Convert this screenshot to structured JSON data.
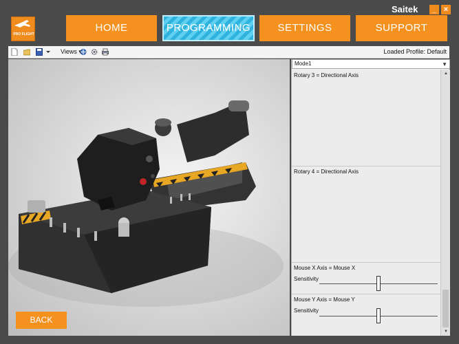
{
  "window": {
    "brand": "Saitek",
    "minimize": "_",
    "close": "×"
  },
  "logo": {
    "text": "PRO FLIGHT"
  },
  "nav": {
    "home": "HOME",
    "programming": "PROGRAMMING",
    "settings": "SETTINGS",
    "support": "SUPPORT"
  },
  "toolbar": {
    "views_label": "Views",
    "loaded_profile": "Loaded Profile: Default"
  },
  "panel": {
    "mode": "Mode1",
    "rows": [
      {
        "label": "Rotary 3 = Directional Axis"
      },
      {
        "label": "Rotary 4 = Directional Axis"
      },
      {
        "label": "Mouse X Axis = Mouse X",
        "sensitivity_label": "Sensitivity",
        "sensitivity": 0.5
      },
      {
        "label": "Mouse Y Axis = Mouse Y",
        "sensitivity_label": "Sensitivity",
        "sensitivity": 0.5
      }
    ]
  },
  "back": "BACK",
  "colors": {
    "accent": "#f5911e",
    "selected": "#2fb2de",
    "chrome": "#4b4b4b"
  },
  "icons": [
    "new-file-icon",
    "open-folder-icon",
    "save-icon",
    "views-icon",
    "gear-icon",
    "print-icon"
  ]
}
